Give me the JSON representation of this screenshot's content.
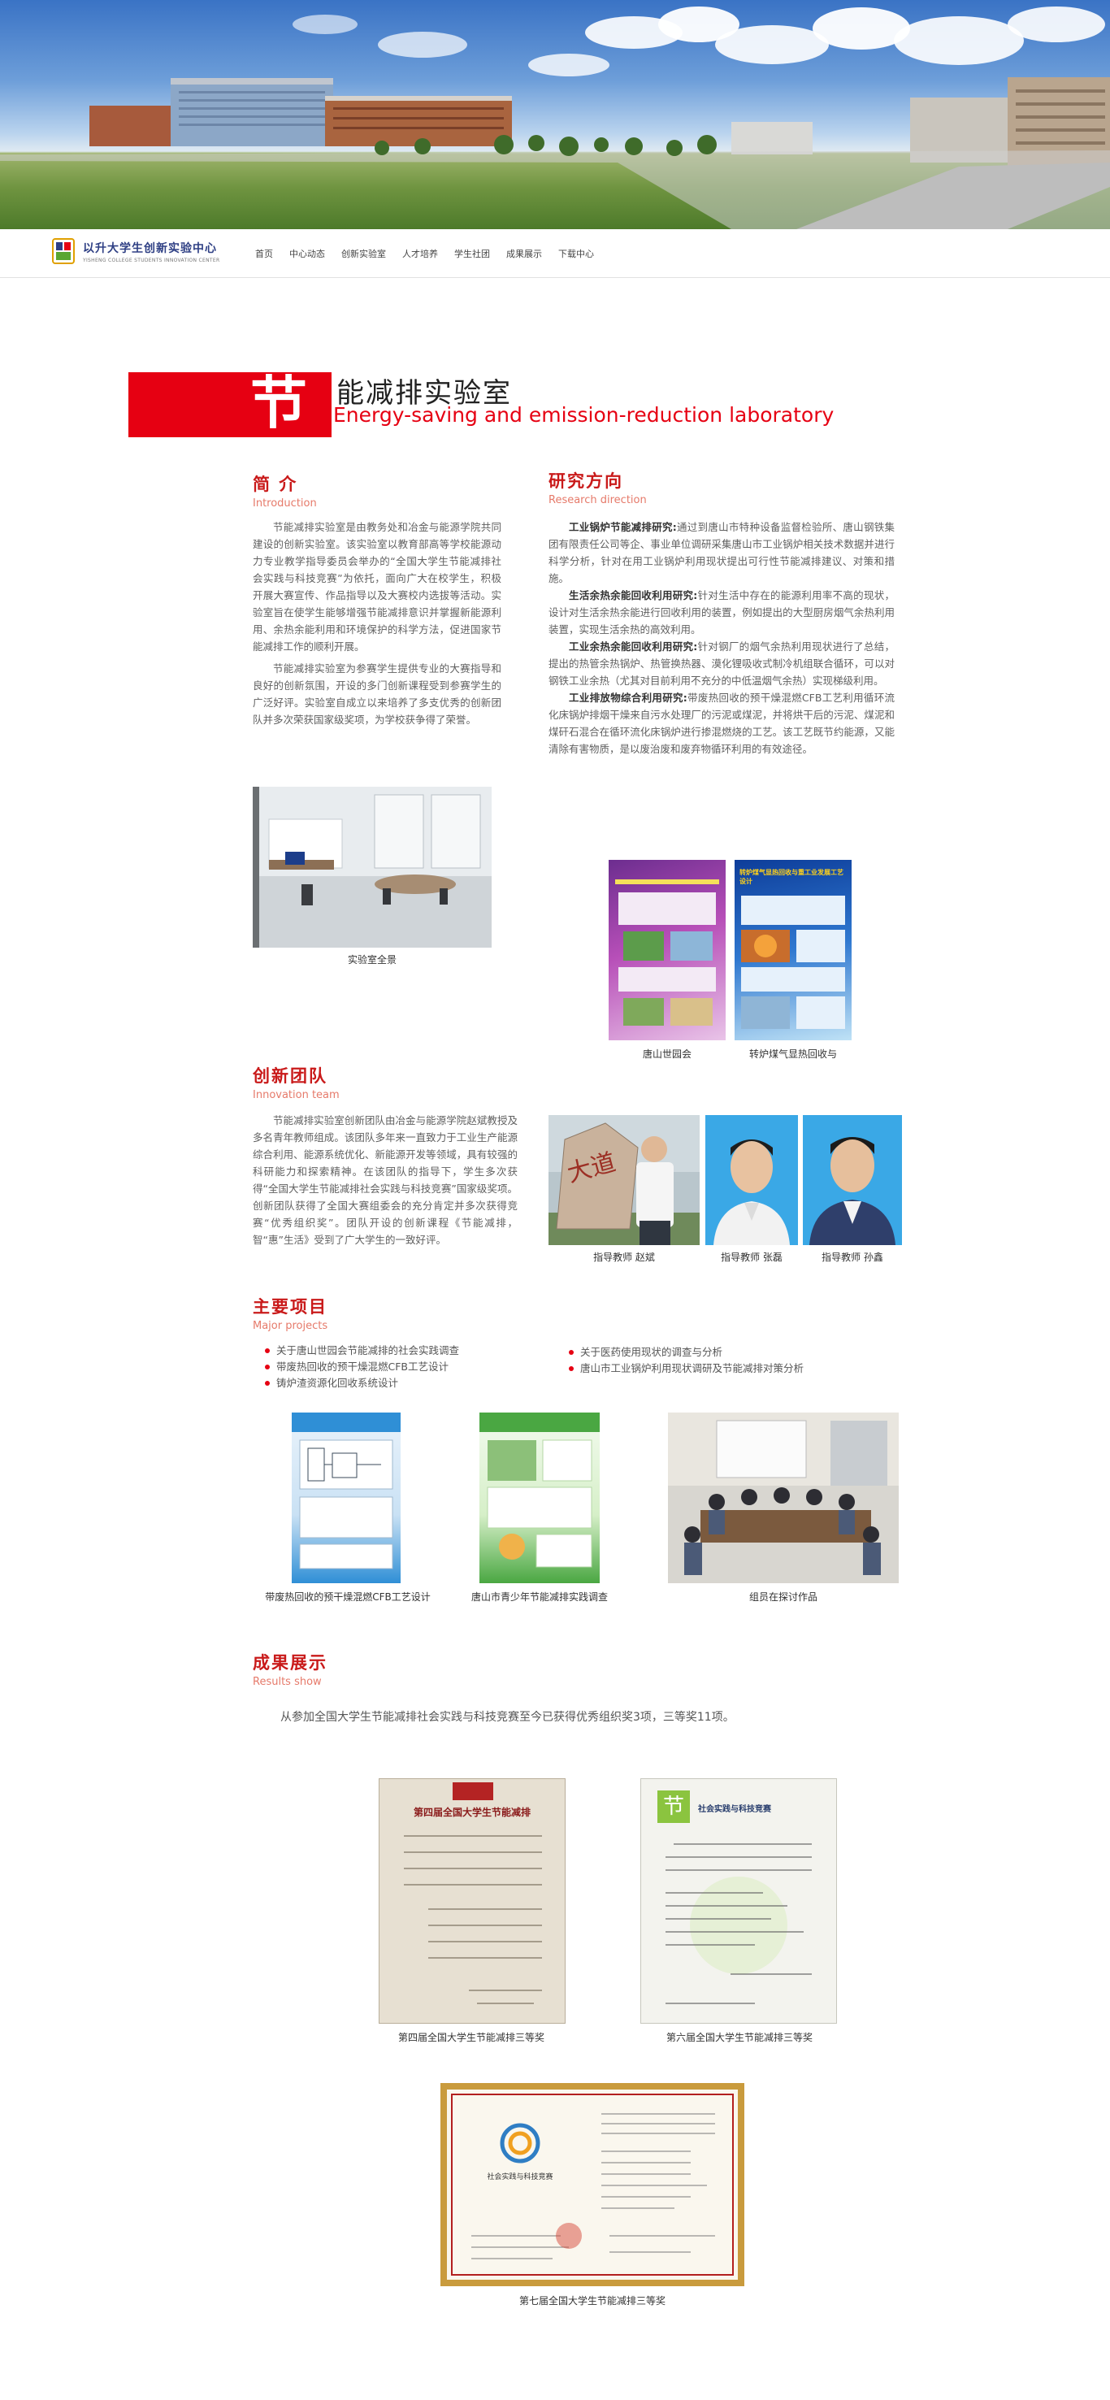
{
  "nav": {
    "logo_cn": "以升大学生创新实验中心",
    "logo_en": "YISHENG COLLEGE STUDENTS INNOVATION CENTER",
    "items": [
      "首页",
      "中心动态",
      "创新实验室",
      "人才培养",
      "学生社团",
      "成果展示",
      "下载中心"
    ]
  },
  "banner": {
    "big_char": "节",
    "title_rest": "能减排实验室",
    "title_en": "Energy-saving and emission-reduction laboratory"
  },
  "intro": {
    "heading": "简 介",
    "heading_en": "Introduction",
    "paragraphs": [
      "节能减排实验室是由教务处和冶金与能源学院共同建设的创新实验室。该实验室以教育部高等学校能源动力专业教学指导委员会举办的“全国大学生节能减排社会实践与科技竞赛”为依托，面向广大在校学生，积极开展大赛宣传、作品指导以及大赛校内选拔等活动。实验室旨在使学生能够增强节能减排意识并掌握新能源利用、余热余能利用和环境保护的科学方法，促进国家节能减排工作的顺利开展。",
      "节能减排实验室为参赛学生提供专业的大赛指导和良好的创新氛围，开设的多门创新课程受到参赛学生的广泛好评。实验室自成立以来培养了多支优秀的创新团队并多次荣获国家级奖项，为学校获争得了荣誉。"
    ],
    "photo_caption": "实验室全景"
  },
  "research": {
    "heading": "研究方向",
    "heading_en": "Research direction",
    "items": [
      {
        "title": "工业锅炉节能减排研究:",
        "text": "通过到唐山市特种设备监督检验所、唐山钢铁集团有限责任公司等企、事业单位调研采集唐山市工业锅炉相关技术数据并进行科学分析，针对在用工业锅炉利用现状提出可行性节能减排建议、对策和措施。"
      },
      {
        "title": "生活余热余能回收利用研究:",
        "text": "针对生活中存在的能源利用率不高的现状，设计对生活余热余能进行回收利用的装置，例如提出的大型厨房烟气余热利用装置，实现生活余热的高效利用。"
      },
      {
        "title": "工业余热余能回收利用研究:",
        "text": "针对钢厂的烟气余热利用现状进行了总结，提出的热管余热锅炉、热管换热器、漠化锂吸收式制冷机组联合循环，可以对钢铁工业余热（尤其对目前利用不充分的中低温烟气余热）实现梯级利用。"
      },
      {
        "title": "工业排放物综合利用研究:",
        "text": "带废热回收的预干燥混燃CFB工艺利用循环流化床锅炉排烟干燥来自污水处理厂的污泥或煤泥，并将烘干后的污泥、煤泥和煤矸石混合在循环流化床锅炉进行掺混燃烧的工艺。该工艺既节约能源，又能清除有害物质，是以废治废和废弃物循环利用的有效途径。"
      }
    ],
    "poster_captions": [
      "唐山世园会",
      "转炉煤气显热回收与"
    ],
    "poster_title": "转炉煤气显热回收与重工业发展工艺设计"
  },
  "team": {
    "heading": "创新团队",
    "heading_en": "Innovation team",
    "paragraph": "节能减排实验室创新团队由冶金与能源学院赵斌教授及多名青年教师组成。该团队多年来一直致力于工业生产能源综合利用、能源系统优化、新能源开发等领域，具有较强的科研能力和探索精神。在该团队的指导下，学生多次获得“全国大学生节能减排社会实践与科技竞赛”国家级奖项。创新团队获得了全国大赛组委会的充分肯定并多次获得竞赛“优秀组织奖”。团队开设的创新课程《节能减排，智“惠”生活》受到了广大学生的一致好评。",
    "members": [
      "指导教师 赵斌",
      "指导教师 张磊",
      "指导教师 孙鑫"
    ],
    "stone_text": "大道"
  },
  "projects": {
    "heading": "主要项目",
    "heading_en": "Major projects",
    "left_list": [
      "关于唐山世园会节能减排的社会实践调查",
      "带废热回收的预干燥混燃CFB工艺设计",
      "铸炉渣资源化回收系统设计"
    ],
    "right_list": [
      "关于医药使用现状的调查与分析",
      "唐山市工业锅炉利用现状调研及节能减排对策分析"
    ],
    "captions": [
      "带废热回收的预干燥混燃CFB工艺设计",
      "唐山市青少年节能减排实践调查",
      "组员在探讨作品"
    ]
  },
  "results": {
    "heading": "成果展示",
    "heading_en": "Results show",
    "summary": "从参加全国大学生节能减排社会实践与科技竞赛至今已获得优秀组织奖3项，三等奖11项。",
    "captions": [
      "第四届全国大学生节能减排三等奖",
      "第六届全国大学生节能减排三等奖",
      "第七届全国大学生节能减排三等奖"
    ],
    "cert1_title": "第四届全国大学生节能减排",
    "cert2_title": "社会实践与科技竞赛",
    "cert2_logo_char": "节",
    "cert3_title": "社会实践与科技竞赛"
  },
  "colors": {
    "accent_red": "#e60012",
    "heading_red": "#c91a1a",
    "logo_blue": "#2e3f84"
  }
}
